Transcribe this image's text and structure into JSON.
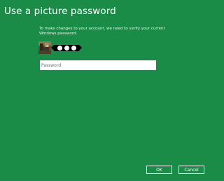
{
  "dialog": {
    "title": "Use a picture password",
    "instructions": "To make changes to your account, we need to verify your current Windows password.",
    "colors": {
      "background": "#1a8c48",
      "text": "#ffffff"
    }
  },
  "account": {
    "avatar_icon": "user-photo",
    "masked_username_icon": "obscured-name"
  },
  "password": {
    "placeholder": "Password",
    "value": ""
  },
  "buttons": {
    "ok_label": "OK",
    "cancel_label": "Cancel"
  }
}
